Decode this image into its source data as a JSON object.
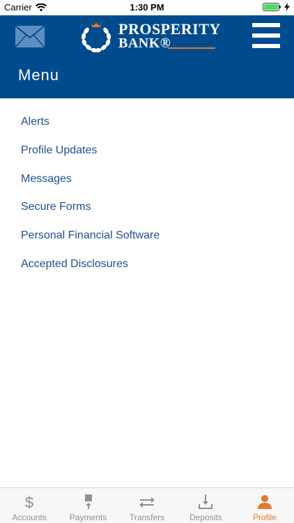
{
  "status_bar": {
    "carrier": "Carrier",
    "time": "1:30 PM"
  },
  "header": {
    "title": "Menu",
    "logo": {
      "line1": "PROSPERITY",
      "line2": "BANK®"
    },
    "color": "#004b8d",
    "accent": "#e07a2e"
  },
  "menu": {
    "items": [
      {
        "label": "Alerts"
      },
      {
        "label": "Profile Updates"
      },
      {
        "label": "Messages"
      },
      {
        "label": "Secure Forms"
      },
      {
        "label": "Personal Financial Software"
      },
      {
        "label": "Accepted Disclosures"
      }
    ],
    "link_color": "#1e4f8f"
  },
  "tabs": {
    "items": [
      {
        "label": "Accounts",
        "icon": "dollar-icon"
      },
      {
        "label": "Payments",
        "icon": "payments-icon"
      },
      {
        "label": "Transfers",
        "icon": "transfers-icon"
      },
      {
        "label": "Deposits",
        "icon": "deposit-icon"
      },
      {
        "label": "Profile",
        "icon": "person-icon",
        "active": true
      }
    ],
    "active_color": "#e07a2e",
    "inactive_color": "#8e8e93"
  }
}
